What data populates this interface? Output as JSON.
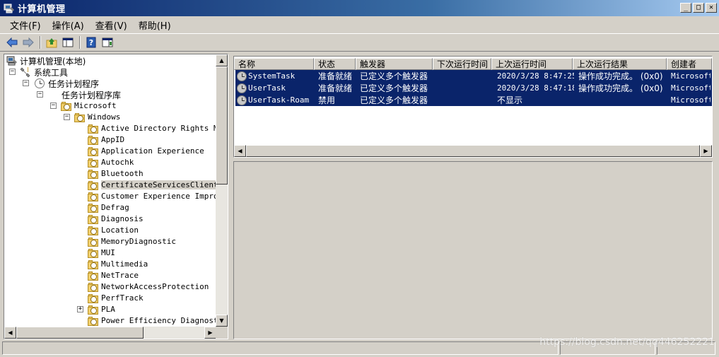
{
  "window": {
    "title": "计算机管理"
  },
  "menu": [
    {
      "label": "文件(F)"
    },
    {
      "label": "操作(A)"
    },
    {
      "label": "查看(V)"
    },
    {
      "label": "帮助(H)"
    }
  ],
  "toolbar": [
    {
      "icon": "back-arrow-icon"
    },
    {
      "icon": "forward-arrow-icon"
    },
    {
      "icon": "up-folder-icon"
    },
    {
      "icon": "show-hide-tree-icon"
    },
    {
      "icon": "help-icon"
    },
    {
      "icon": "show-hide-action-pane-icon"
    }
  ],
  "tree": {
    "root": "计算机管理(本地)",
    "system_tools": "系统工具",
    "task_scheduler": "任务计划程序",
    "task_library": "任务计划程序库",
    "microsoft": "Microsoft",
    "windows": "Windows",
    "children": [
      {
        "label": "Active Directory Rights Mar"
      },
      {
        "label": "AppID"
      },
      {
        "label": "Application Experience"
      },
      {
        "label": "Autochk"
      },
      {
        "label": "Bluetooth"
      },
      {
        "label": "CertificateServicesClient",
        "selected": true
      },
      {
        "label": "Customer Experience Improve"
      },
      {
        "label": "Defrag"
      },
      {
        "label": "Diagnosis"
      },
      {
        "label": "Location"
      },
      {
        "label": "MemoryDiagnostic"
      },
      {
        "label": "MUI"
      },
      {
        "label": "Multimedia"
      },
      {
        "label": "NetTrace"
      },
      {
        "label": "NetworkAccessProtection"
      },
      {
        "label": "PerfTrack"
      },
      {
        "label": "PLA"
      },
      {
        "label": "Power Efficiency Diagnostic"
      }
    ]
  },
  "list": {
    "columns": [
      {
        "label": "名称"
      },
      {
        "label": "状态"
      },
      {
        "label": "触发器"
      },
      {
        "label": "下次运行时间"
      },
      {
        "label": "上次运行时间"
      },
      {
        "label": "上次运行结果"
      },
      {
        "label": "创建者"
      }
    ],
    "rows": [
      {
        "name": "SystemTask",
        "status": "准备就绪",
        "trigger": "已定义多个触发器",
        "next": "",
        "last": "2020/3/28 8:47:25",
        "result": "操作成功完成。 (0x0)",
        "author": "Microsoft"
      },
      {
        "name": "UserTask",
        "status": "准备就绪",
        "trigger": "已定义多个触发器",
        "next": "",
        "last": "2020/3/28 8:47:18",
        "result": "操作成功完成。 (0x0)",
        "author": "Microsoft"
      },
      {
        "name": "UserTask-Roam",
        "status": "禁用",
        "trigger": "已定义多个触发器",
        "next": "",
        "last": "不显示",
        "result": "",
        "author": "Microsoft"
      }
    ]
  },
  "watermark": "https://blog.csdn.net/qq446252221"
}
